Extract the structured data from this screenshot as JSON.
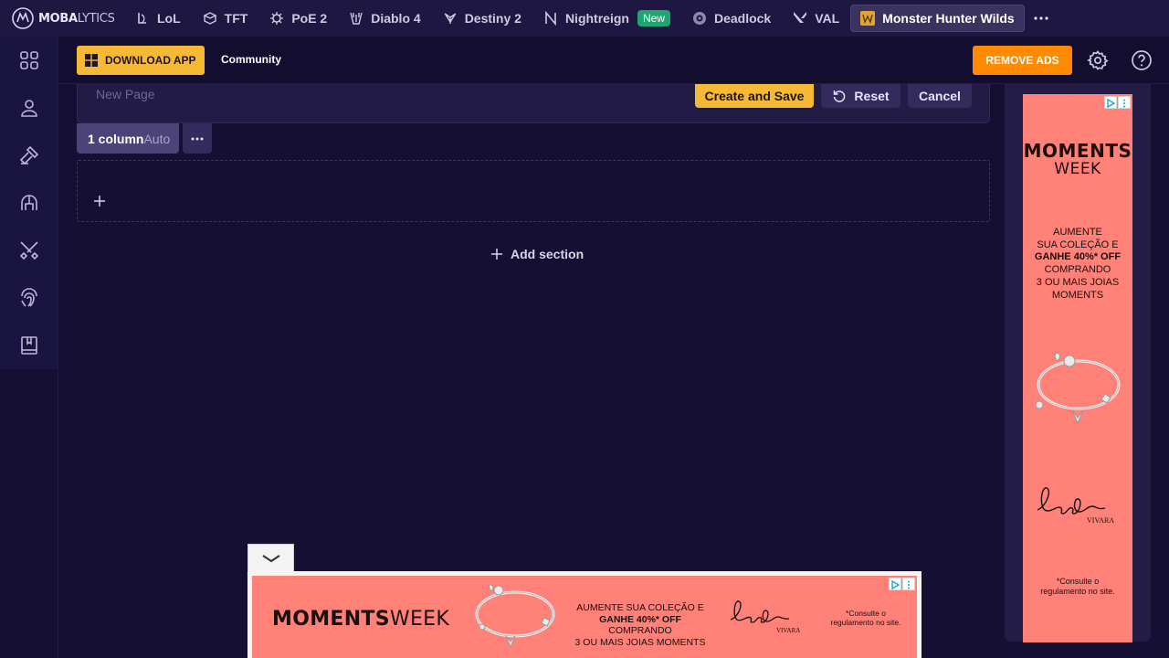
{
  "brand": {
    "name_bold": "MOBA",
    "name_light": "LYTICS"
  },
  "games": [
    {
      "label": "LoL",
      "icon": "lol-icon"
    },
    {
      "label": "TFT",
      "icon": "tft-icon"
    },
    {
      "label": "PoE 2",
      "icon": "poe2-icon"
    },
    {
      "label": "Diablo 4",
      "icon": "diablo4-icon"
    },
    {
      "label": "Destiny 2",
      "icon": "destiny2-icon"
    },
    {
      "label": "Nightreign",
      "icon": "nightreign-icon",
      "badge": "New"
    },
    {
      "label": "Deadlock",
      "icon": "deadlock-icon"
    },
    {
      "label": "VAL",
      "icon": "valorant-icon"
    },
    {
      "label": "Monster Hunter Wilds",
      "icon": "mhwilds-icon",
      "active": true
    }
  ],
  "sidebar": {
    "items": [
      {
        "name": "dashboard",
        "icon": "grid-icon"
      },
      {
        "name": "profile",
        "icon": "user-icon"
      },
      {
        "name": "builds",
        "icon": "hammer-icon"
      },
      {
        "name": "monsters",
        "icon": "helmet-icon"
      },
      {
        "name": "weapons",
        "icon": "crossed-swords-icon"
      },
      {
        "name": "tracker",
        "icon": "fingerprint-icon"
      },
      {
        "name": "guides",
        "icon": "book-icon"
      }
    ]
  },
  "header": {
    "download_label": "DOWNLOAD APP",
    "community_label": "Community",
    "remove_ads_label": "REMOVE ADS"
  },
  "editor": {
    "page_name_placeholder": "New Page",
    "create_save_label": "Create and Save",
    "reset_label": "Reset",
    "cancel_label": "Cancel",
    "column_label": "1 column",
    "column_mode": "Auto",
    "add_section_label": "Add section"
  },
  "ads": {
    "side": {
      "title_bold": "MOMENTS",
      "title_light": "WEEK",
      "line1": "AUMENTE",
      "line2": "SUA COLEÇÃO E",
      "line3": "GANHE 40%* OFF",
      "line4": "COMPRANDO",
      "line5": "3 OU MAIS JOIAS",
      "line6": "MOMENTS",
      "logo": "Life",
      "logo_sub": "VIVARA",
      "note1": "*Consulte o",
      "note2": "regulamento no site."
    },
    "bottom": {
      "title_bold": "MOMENTS",
      "title_light": "WEEK",
      "line1": "AUMENTE SUA COLEÇÃO E",
      "line2_bold": "GANHE 40%* OFF",
      "line2_rest": " COMPRANDO",
      "line3": "3 OU MAIS JOIAS MOMENTS",
      "logo": "Life",
      "logo_sub": "VIVARA",
      "note1": "*Consulte o",
      "note2": "regulamento no site."
    }
  },
  "colors": {
    "background": "#150f33",
    "accent_yellow": "#f5b935",
    "accent_orange": "#ff8a00",
    "badge_green": "#1fa56f",
    "ad_coral": "#ff8178"
  }
}
